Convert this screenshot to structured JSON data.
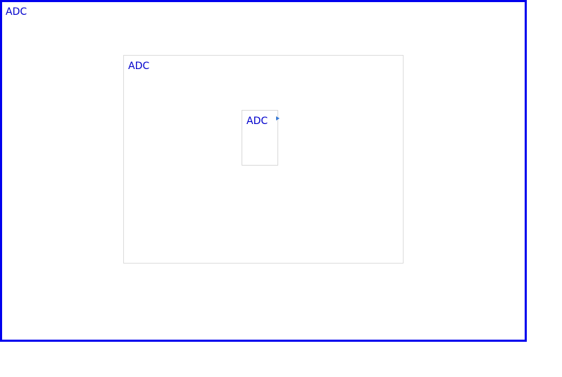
{
  "frames": {
    "outer": {
      "label": "ADC"
    },
    "middle": {
      "label": "ADC"
    },
    "inner": {
      "label": "ADC"
    }
  },
  "colors": {
    "label_text": "#0000cc",
    "outer_border": "#0000ee",
    "nested_border": "#dcdcdc",
    "marker": "#3a7bd5"
  },
  "icons": {
    "marker": "triangle-right-icon"
  }
}
